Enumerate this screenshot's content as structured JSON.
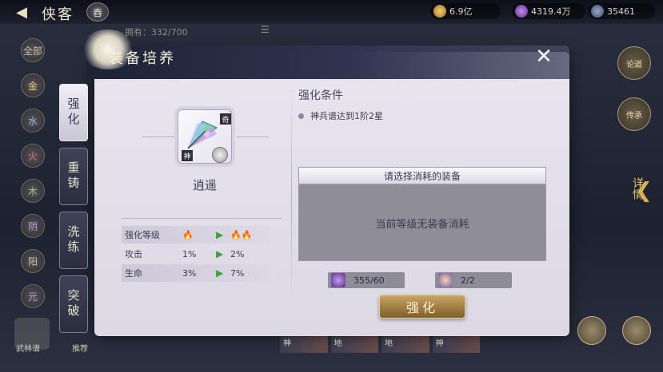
{
  "topbar": {
    "title": "侠客",
    "badge": "舂",
    "resources": [
      {
        "icon": "coin-icon",
        "value": "6.9亿"
      },
      {
        "icon": "gem-icon",
        "value": "4319.4万"
      },
      {
        "icon": "token-icon",
        "value": "35461"
      }
    ]
  },
  "background": {
    "owned": "拥有：332/700",
    "elements": [
      "全部",
      "金",
      "水",
      "火",
      "木",
      "阴",
      "阳",
      "元"
    ],
    "bottom_left_label": "武林谱",
    "tui_label": "推荐",
    "right_buttons": [
      "论道",
      "传承"
    ],
    "detail": "详情",
    "card_labels": [
      "神",
      "地",
      "地",
      "神"
    ]
  },
  "modal": {
    "title": "装备培养",
    "tabs": [
      {
        "label": "强化",
        "active": true
      },
      {
        "label": "重铸",
        "active": false
      },
      {
        "label": "洗练",
        "active": false
      },
      {
        "label": "突破",
        "active": false
      }
    ],
    "item": {
      "name": "逍遥",
      "tag": "奇",
      "shen": "神"
    },
    "stats": [
      {
        "label": "强化等级",
        "current": "1",
        "next": "2"
      },
      {
        "label": "攻击",
        "current": "1%",
        "next": "2%"
      },
      {
        "label": "生命",
        "current": "3%",
        "next": "7%"
      }
    ],
    "condition_title": "强化条件",
    "condition_item": "神兵谱达到1阶2星",
    "select_header": "请选择消耗的装备",
    "select_empty": "当前等级无装备消耗",
    "costs": [
      {
        "icon": "crystal-icon",
        "value": "355/60"
      },
      {
        "icon": "scroll-icon",
        "value": "2/2"
      }
    ],
    "enhance_button": "强化"
  },
  "colors": {
    "accent_gold": "#9c7a3e",
    "panel_bg": "#e9e6ef",
    "header_dark": "#2f3550",
    "arrow_green": "#3fa43f"
  }
}
